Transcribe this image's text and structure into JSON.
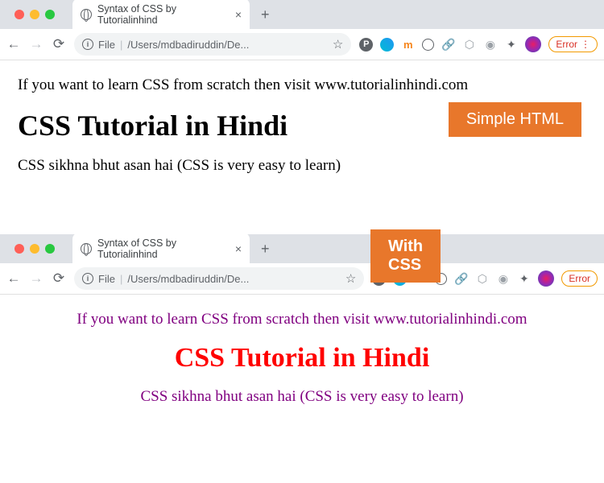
{
  "browser": {
    "tab_title": "Syntax of CSS by Tutorialinhind",
    "url_scheme": "File",
    "url_path": "/Users/mdbadiruddin/De...",
    "error_label": "Error"
  },
  "badges": {
    "simple": "Simple HTML",
    "withcss": "With CSS"
  },
  "content": {
    "intro": "If you want to learn CSS from scratch then visit www.tutorialinhindi.com",
    "heading": "CSS Tutorial in Hindi",
    "sub": "CSS sikhna bhut asan hai (CSS is very easy to learn)"
  }
}
